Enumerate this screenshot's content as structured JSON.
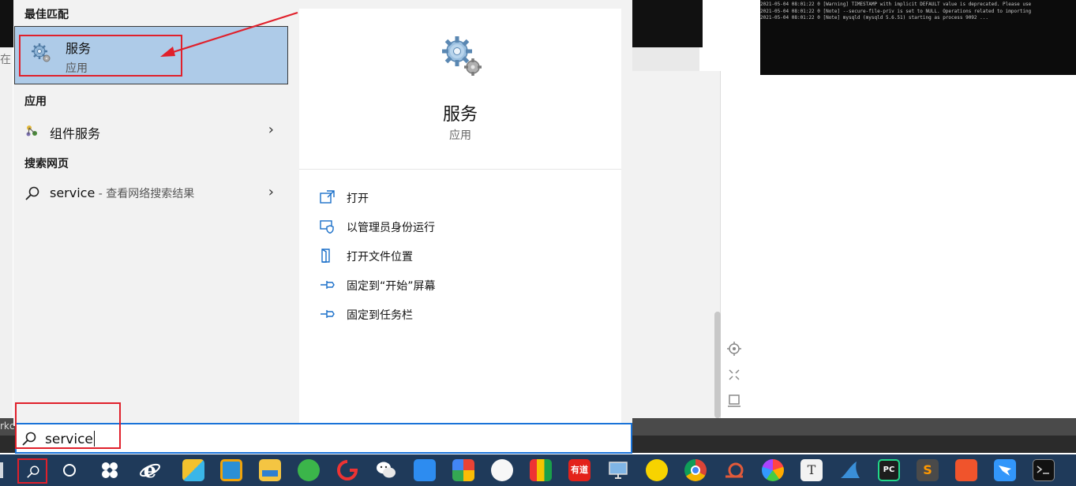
{
  "search_panel": {
    "best_match_header": "最佳匹配",
    "best_match": {
      "title": "服务",
      "subtitle": "应用"
    },
    "apps_header": "应用",
    "apps": [
      {
        "label": "组件服务"
      }
    ],
    "web_header": "搜索网页",
    "web_result": {
      "query": "service",
      "suffix": " - 查看网络搜索结果"
    },
    "chevron": "›"
  },
  "detail": {
    "title": "服务",
    "subtitle": "应用",
    "actions": [
      {
        "label": "打开",
        "icon": "open-icon"
      },
      {
        "label": "以管理员身份运行",
        "icon": "admin-shield-icon"
      },
      {
        "label": "打开文件位置",
        "icon": "file-location-icon"
      },
      {
        "label": "固定到“开始”屏幕",
        "icon": "pin-icon"
      },
      {
        "label": "固定到任务栏",
        "icon": "pin-icon"
      }
    ]
  },
  "search_box": {
    "value": "service"
  },
  "background": {
    "left_char": "在",
    "band_text": "rkc",
    "console_lines": [
      "2021-05-04 08:01:22 0 [Warning] TIMESTAMP with implicit DEFAULT value is deprecated. Please use",
      "2021-05-04 08:01:22 0 [Note] --secure-file-priv is set to NULL. Operations related to importing",
      "2021-05-04 08:01:22 0 [Note] mysqld (mysqld 5.6.51) starting as process 9092 ..."
    ]
  },
  "taskbar": {
    "icons": [
      "cortana-icon",
      "pinwheel-icon",
      "ie-icon",
      "grid-app-icon",
      "vmware-icon",
      "file-explorer-icon",
      "green-app-icon",
      "red-app-icon",
      "wechat-icon",
      "blue-app-icon",
      "photos-icon",
      "fan-icon",
      "flag-icon",
      "youdao-icon",
      "monitor-icon",
      "yellow-app-icon",
      "chrome-icon",
      "snail-icon",
      "color-wheel-icon",
      "typora-icon",
      "shark-icon",
      "pycharm-icon",
      "sublime-icon",
      "orange-app-icon",
      "dingtalk-icon",
      "terminal-icon"
    ],
    "youdao_label": "有道",
    "typora_label": "T",
    "pycharm_label": "PC",
    "sublime_label": "S"
  }
}
